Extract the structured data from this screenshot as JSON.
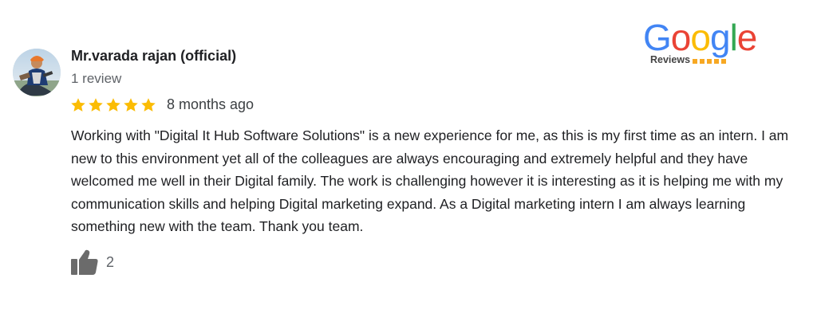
{
  "reviewer": {
    "name": "Mr.varada rajan (official)",
    "review_count": "1 review",
    "avatar_icon": "user-photo-avatar"
  },
  "rating": {
    "stars": 5,
    "max": 5,
    "star_icon": "star-icon",
    "color": "#fbbc04",
    "time_ago": "8 months ago"
  },
  "review": {
    "text": "Working with \"Digital It Hub Software Solutions\" is a new experience for me, as this is my first time as an intern. I am new to this environment yet all of the colleagues are always encouraging and extremely helpful and they have welcomed me well in their Digital family. The work is challenging however it is interesting as it is helping me with my communication skills and helping Digital marketing expand. As a Digital marketing intern I am always learning something new with the team. Thank you team."
  },
  "likes": {
    "icon": "thumbs-up-icon",
    "count": "2"
  },
  "badge": {
    "letters": [
      {
        "char": "G",
        "color": "#4285f4"
      },
      {
        "char": "o",
        "color": "#ea4335"
      },
      {
        "char": "o",
        "color": "#fbbc05"
      },
      {
        "char": "g",
        "color": "#4285f4"
      },
      {
        "char": "l",
        "color": "#34a853"
      },
      {
        "char": "e",
        "color": "#ea4335"
      }
    ],
    "subtitle": "Reviews",
    "mini_star_color": "#f7a823"
  }
}
